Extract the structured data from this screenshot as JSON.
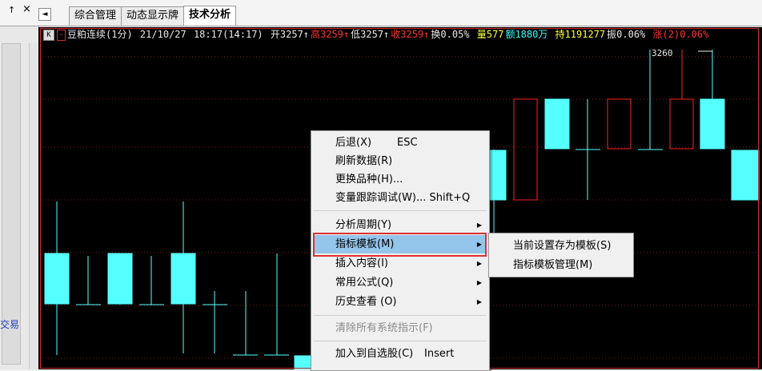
{
  "left_panel": {
    "pin_label": "↑",
    "close_label": "×",
    "text": "交易"
  },
  "tabs": [
    {
      "label": "综合管理"
    },
    {
      "label": "动态显示牌"
    },
    {
      "label": "技术分析"
    }
  ],
  "tab_scroll_label": "◄",
  "infobar": {
    "k_button": "K",
    "minus_button": "-",
    "instrument": "豆粕连续(1分)",
    "date": "21/10/27",
    "time": "18:17(14:17)",
    "open": "开3257↑",
    "high": "高3259↑",
    "low": "低3257↑",
    "close": "收3259↑",
    "turnover_rate": "换0.05%",
    "volume": "量577",
    "amount": "额1880万",
    "position": "持1191277",
    "amplitude": "振0.06%",
    "change": "涨(2)0.06%",
    "colors": {
      "normal": "#e8e8e8",
      "up": "#ff3333",
      "yellow": "#ffff33",
      "cyan": "#33ffff",
      "pink": "#ff66ff"
    }
  },
  "chart_data": {
    "type": "candlestick",
    "price_label": "3260",
    "up_color": "#ff2020",
    "down_color": "#55ffff"
  },
  "context_menu": {
    "items": [
      {
        "label": "后退(X)",
        "shortcut": "ESC"
      },
      {
        "label": "刷新数据(R)"
      },
      {
        "label": "更换品种(H)..."
      },
      {
        "label": "变量跟踪调试(W)... Shift+Q"
      },
      {
        "label": "分析周期(Y)",
        "submenu": true
      },
      {
        "label": "指标模板(M)",
        "submenu": true,
        "highlighted": true
      },
      {
        "label": "插入内容(I)",
        "submenu": true
      },
      {
        "label": "常用公式(Q)",
        "submenu": true
      },
      {
        "label": "历史查看 (O)",
        "submenu": true
      },
      {
        "label": "清除所有系统指示(F)",
        "disabled": true
      },
      {
        "label": "加入到自选股(C)",
        "shortcut": "Insert"
      }
    ]
  },
  "submenu": {
    "items": [
      {
        "label": "当前设置存为模板(S)"
      },
      {
        "label": "指标模板管理(M)"
      }
    ]
  }
}
